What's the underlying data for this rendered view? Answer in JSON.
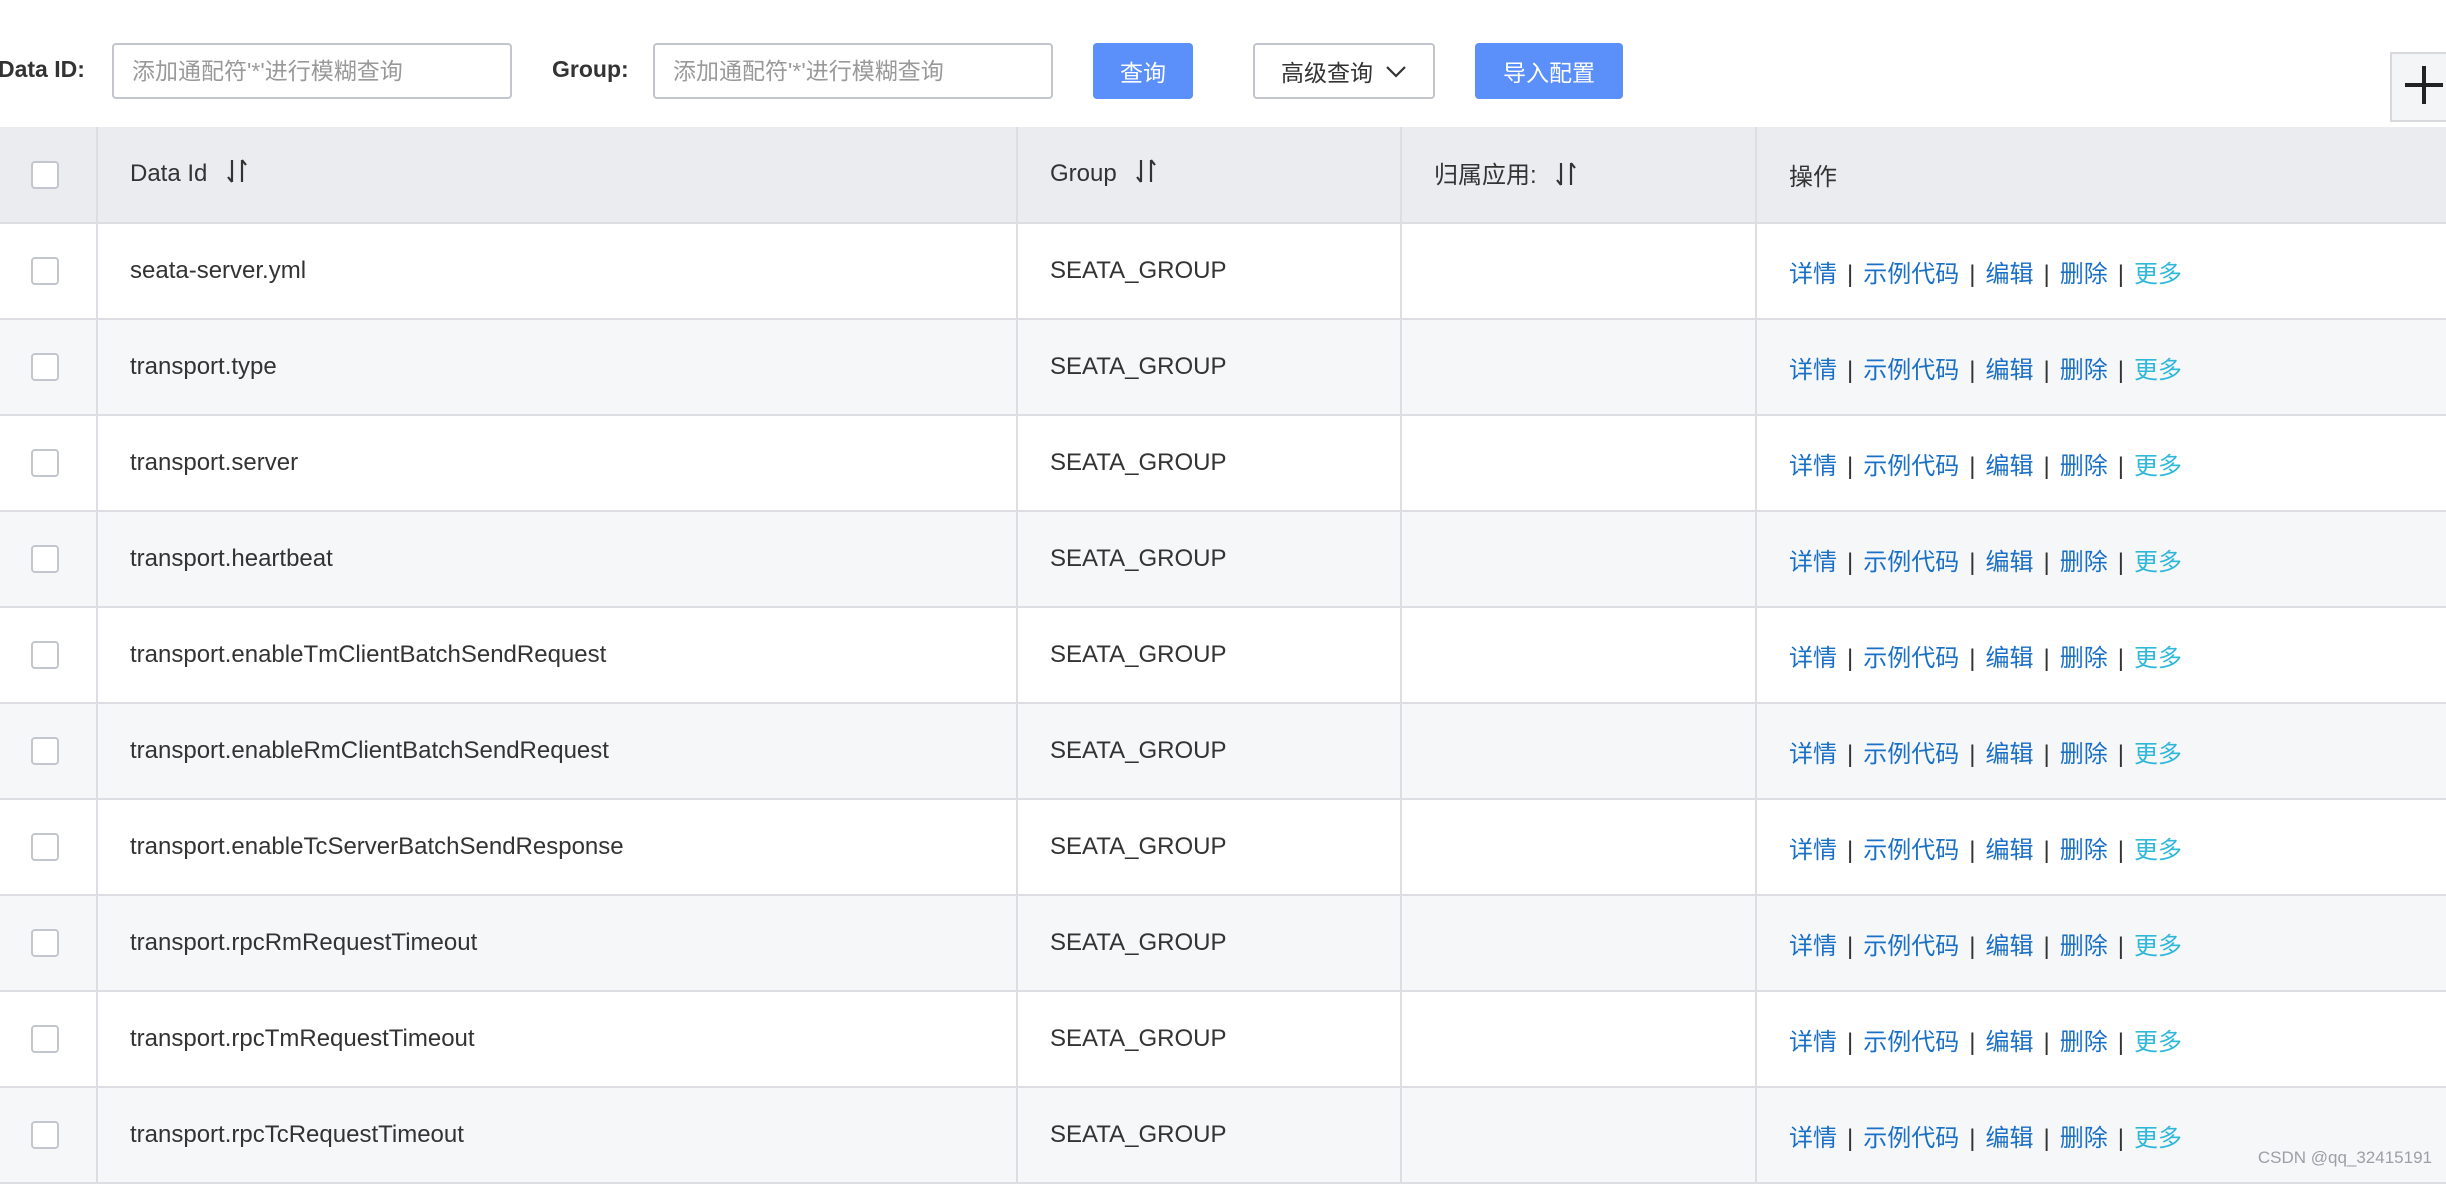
{
  "search": {
    "data_id_label": "Data ID:",
    "data_id_placeholder": "添加通配符'*'进行模糊查询",
    "group_label": "Group:",
    "group_placeholder": "添加通配符'*'进行模糊查询",
    "query_button": "查询",
    "advanced_button": "高级查询",
    "import_button": "导入配置"
  },
  "table": {
    "headers": {
      "data_id": "Data Id",
      "group": "Group",
      "app": "归属应用:",
      "ops": "操作"
    },
    "actions": {
      "detail": "详情",
      "sample": "示例代码",
      "edit": "编辑",
      "delete": "删除",
      "more": "更多",
      "separator": "|"
    },
    "rows": [
      {
        "data_id": "seata-server.yml",
        "group": "SEATA_GROUP",
        "app": ""
      },
      {
        "data_id": "transport.type",
        "group": "SEATA_GROUP",
        "app": ""
      },
      {
        "data_id": "transport.server",
        "group": "SEATA_GROUP",
        "app": ""
      },
      {
        "data_id": "transport.heartbeat",
        "group": "SEATA_GROUP",
        "app": ""
      },
      {
        "data_id": "transport.enableTmClientBatchSendRequest",
        "group": "SEATA_GROUP",
        "app": ""
      },
      {
        "data_id": "transport.enableRmClientBatchSendRequest",
        "group": "SEATA_GROUP",
        "app": ""
      },
      {
        "data_id": "transport.enableTcServerBatchSendResponse",
        "group": "SEATA_GROUP",
        "app": ""
      },
      {
        "data_id": "transport.rpcRmRequestTimeout",
        "group": "SEATA_GROUP",
        "app": ""
      },
      {
        "data_id": "transport.rpcTmRequestTimeout",
        "group": "SEATA_GROUP",
        "app": ""
      },
      {
        "data_id": "transport.rpcTcRequestTimeout",
        "group": "SEATA_GROUP",
        "app": ""
      }
    ]
  },
  "watermark": "CSDN @qq_32415191",
  "colors": {
    "primary": "#5b8ff9",
    "link": "#1a6fc7",
    "more_link": "#2fb8d9",
    "header_bg": "#ebecf0",
    "alt_row_bg": "#f6f7f9"
  }
}
